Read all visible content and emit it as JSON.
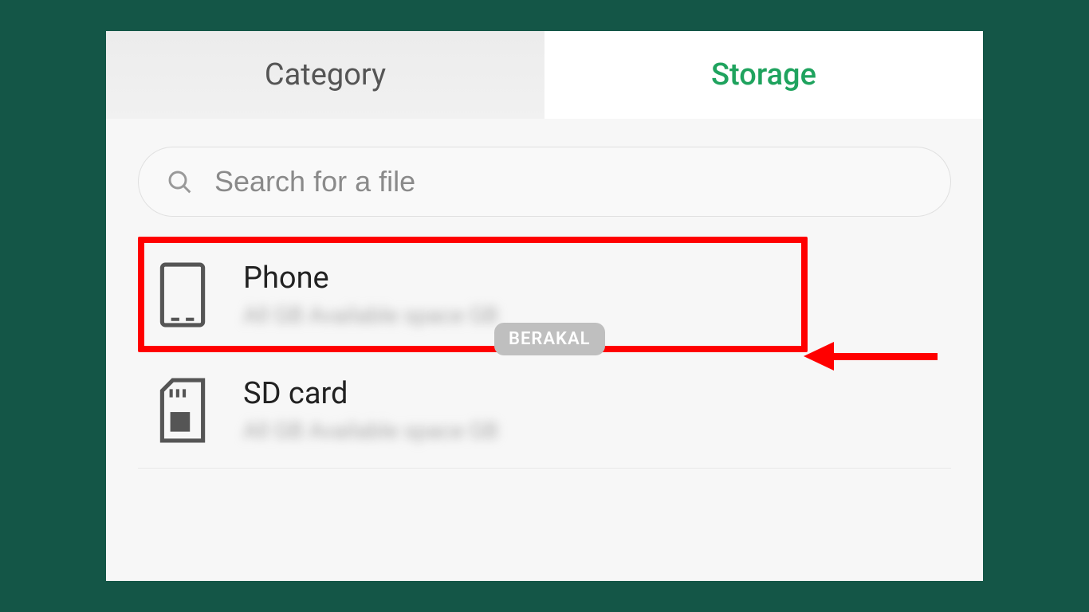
{
  "tabs": {
    "category": "Category",
    "storage": "Storage"
  },
  "search": {
    "placeholder": "Search for a file"
  },
  "storage_items": [
    {
      "title": "Phone",
      "subtitle": "All    GB Available space     GB"
    },
    {
      "title": "SD card",
      "subtitle": "All    GB Available space    GB"
    }
  ],
  "watermark": "BERAKAL"
}
